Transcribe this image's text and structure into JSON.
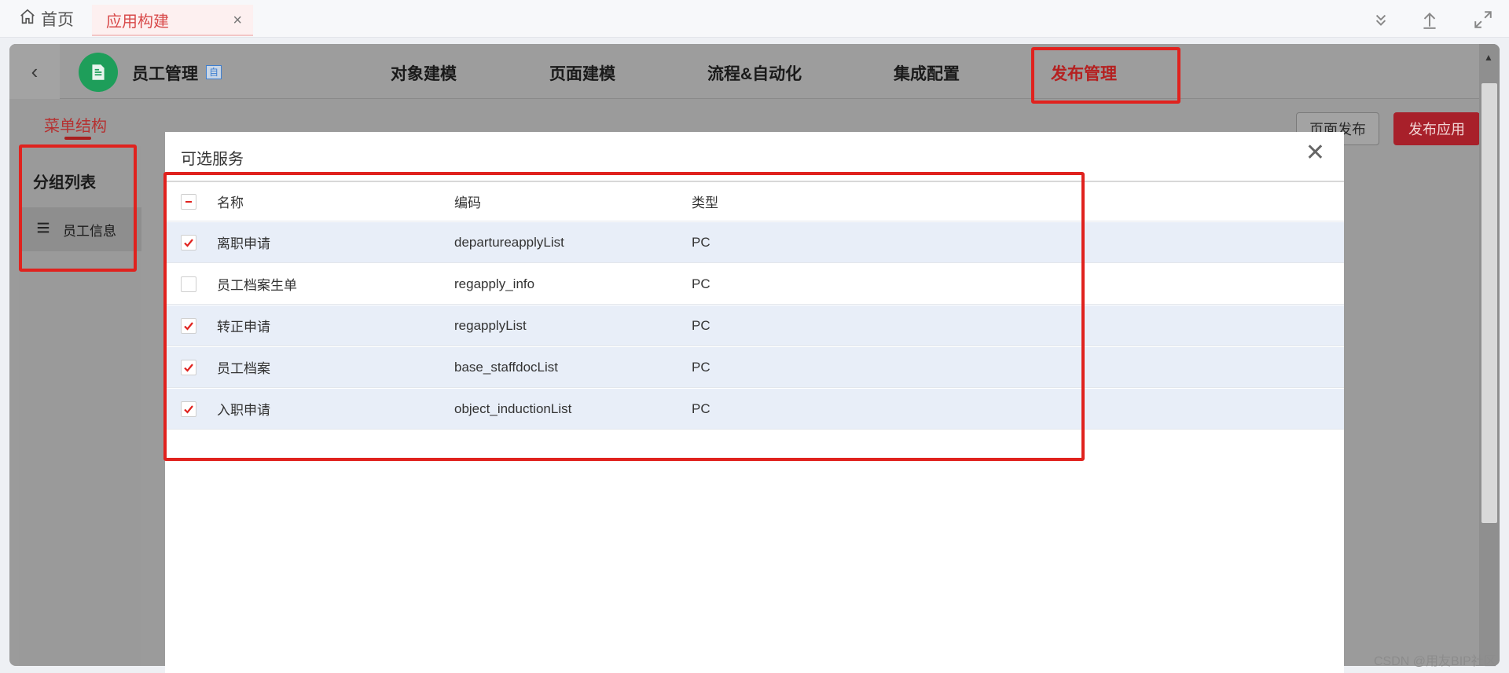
{
  "tabs": {
    "home_label": "首页",
    "active_label": "应用构建",
    "close_glyph": "×"
  },
  "app": {
    "name": "员工管理",
    "tag": "自",
    "back_glyph": "‹"
  },
  "nav": [
    {
      "label": "对象建模"
    },
    {
      "label": "页面建模"
    },
    {
      "label": "流程&自动化"
    },
    {
      "label": "集成配置"
    },
    {
      "label": "发布管理",
      "active": true
    }
  ],
  "sidebar": {
    "menu_structure_label": "菜单结构",
    "group_list_title": "分组列表",
    "items": [
      {
        "label": "员工信息"
      }
    ]
  },
  "actions": {
    "page_publish_label": "页面发布",
    "app_publish_label": "发布应用"
  },
  "dialog": {
    "title": "可选服务",
    "close_glyph": "✕",
    "columns": [
      "名称",
      "编码",
      "类型"
    ],
    "rows": [
      {
        "name": "离职申请",
        "code": "departureapplyList",
        "type": "PC",
        "checked": true
      },
      {
        "name": "员工档案生单",
        "code": "regapply_info",
        "type": "PC",
        "checked": false
      },
      {
        "name": "转正申请",
        "code": "regapplyList",
        "type": "PC",
        "checked": true
      },
      {
        "name": "员工档案",
        "code": "base_staffdocList",
        "type": "PC",
        "checked": true
      },
      {
        "name": "入职申请",
        "code": "object_inductionList",
        "type": "PC",
        "checked": true
      }
    ]
  },
  "watermark": "CSDN @用友BIP社区",
  "colors": {
    "accent_red": "#b52020",
    "highlight_box": "#e0221e",
    "selected_row": "#e8eef8",
    "app_logo": "#1e9e5a"
  },
  "icons": {
    "home": "home-icon",
    "collapse": "double-chevron-down-icon",
    "upload": "upload-icon",
    "fullscreen": "fullscreen-icon",
    "menu": "hamburger-icon"
  }
}
